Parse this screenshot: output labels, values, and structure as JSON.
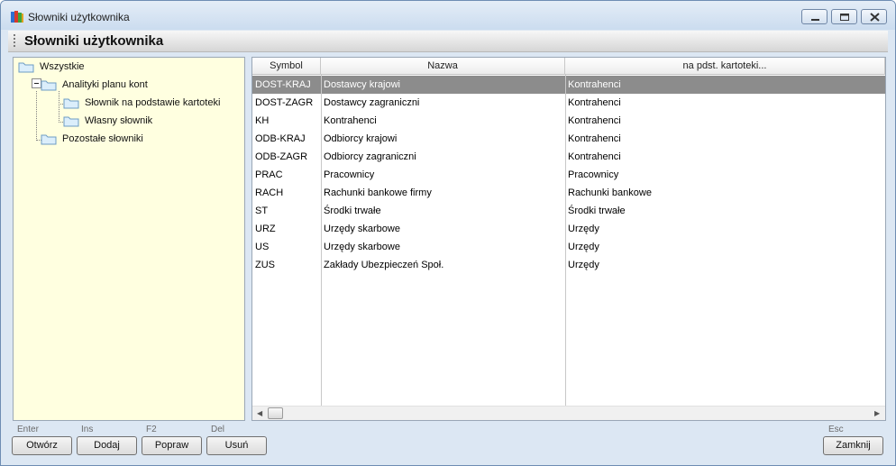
{
  "window": {
    "title": "Słowniki użytkownika",
    "header_title": "Słowniki użytkownika"
  },
  "tree": {
    "items": [
      {
        "label": "Wszystkie"
      },
      {
        "label": "Analityki planu kont"
      },
      {
        "label": "Słownik na podstawie kartoteki"
      },
      {
        "label": "Własny słownik"
      },
      {
        "label": "Pozostałe słowniki"
      }
    ]
  },
  "grid": {
    "columns": [
      "Symbol",
      "Nazwa",
      "na pdst. kartoteki..."
    ],
    "rows": [
      {
        "symbol": "DOST-KRAJ",
        "nazwa": "Dostawcy krajowi",
        "kartoteka": "Kontrahenci"
      },
      {
        "symbol": "DOST-ZAGR",
        "nazwa": "Dostawcy zagraniczni",
        "kartoteka": "Kontrahenci"
      },
      {
        "symbol": "KH",
        "nazwa": "Kontrahenci",
        "kartoteka": "Kontrahenci"
      },
      {
        "symbol": "ODB-KRAJ",
        "nazwa": "Odbiorcy krajowi",
        "kartoteka": "Kontrahenci"
      },
      {
        "symbol": "ODB-ZAGR",
        "nazwa": "Odbiorcy zagraniczni",
        "kartoteka": "Kontrahenci"
      },
      {
        "symbol": "PRAC",
        "nazwa": "Pracownicy",
        "kartoteka": "Pracownicy"
      },
      {
        "symbol": "RACH",
        "nazwa": "Rachunki bankowe firmy",
        "kartoteka": "Rachunki bankowe"
      },
      {
        "symbol": "ST",
        "nazwa": "Środki trwałe",
        "kartoteka": "Środki trwałe"
      },
      {
        "symbol": "URZ",
        "nazwa": "Urzędy skarbowe",
        "kartoteka": "Urzędy"
      },
      {
        "symbol": "US",
        "nazwa": "Urzędy skarbowe",
        "kartoteka": "Urzędy"
      },
      {
        "symbol": "ZUS",
        "nazwa": "Zakłady Ubezpieczeń Społ.",
        "kartoteka": "Urzędy"
      }
    ]
  },
  "buttons": {
    "open": {
      "key": "Enter",
      "label": "Otwórz"
    },
    "add": {
      "key": "Ins",
      "label": "Dodaj"
    },
    "edit": {
      "key": "F2",
      "label": "Popraw"
    },
    "delete": {
      "key": "Del",
      "label": "Usuń"
    },
    "close": {
      "key": "Esc",
      "label": "Zamknij"
    }
  },
  "colors": {
    "tree_background": "#ffffe0",
    "selected_row": "#8c8c8c",
    "window_frame": "#dce7f3"
  },
  "icons": {
    "app": "books-icon",
    "tree": "folder-icon",
    "window_controls": [
      "minimize-icon",
      "maximize-icon",
      "close-icon"
    ]
  }
}
